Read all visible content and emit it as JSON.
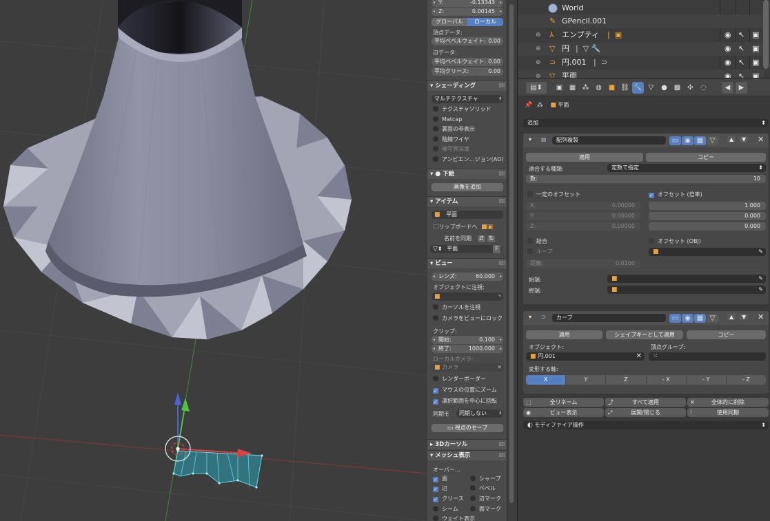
{
  "npanel": {
    "transform": {
      "y_label": "Y:",
      "y_value": "-0.13343",
      "z_label": "Z:",
      "z_value": "0.00145",
      "global_label": "グローバル",
      "local_label": "ローカル",
      "vertex_data_label": "頂点データ:",
      "vertex_bevel_label": "平均ベベルウェイト:",
      "vertex_bevel_value": "0.00",
      "edge_data_label": "辺データ:",
      "edge_bevel_label": "平均ベベルウェイト:",
      "edge_bevel_value": "0.00",
      "crease_label": "平均クリース:",
      "crease_value": "0.00"
    },
    "shading": {
      "header": "シェーディング",
      "mode": "マルチテクスチャ",
      "textured_solid": "テクスチャソリッド",
      "matcap": "Matcap",
      "backface_culling": "裏面の非表示",
      "hidden_wire": "陰線ワイヤ",
      "depth_of_field": "被写界深度",
      "ambient_occlusion": "アンビエン…ジョン(AO)"
    },
    "background": {
      "header": "下絵",
      "add_image": "画像を追加"
    },
    "item": {
      "header": "アイテム",
      "object_name": "平面",
      "clipboard_label": "リップボードへ",
      "sync_name": "名前を同期",
      "data_name": "平面",
      "f_label": "F"
    },
    "view": {
      "header": "ビュー",
      "lens_label": "レンズ:",
      "lens_value": "60.000",
      "lock_object_label": "オブジェクトに注視:",
      "lock_cursor": "カーソルを注視",
      "lock_camera": "カメラをビューにロック",
      "clip_label": "クリップ:",
      "clip_start_label": "開始:",
      "clip_start_value": "0.100",
      "clip_end_label": "終了:",
      "clip_end_value": "1000.000",
      "local_camera_label": "ローカルカメラ:",
      "camera_placeholder": "カメラ",
      "render_border": "レンダーボーダー",
      "zoom_to_mouse": "マウスの位置にズーム",
      "rotate_around_selection": "選択範囲を中心に回転",
      "sync_mode_label": "同期モ",
      "sync_mode_value": "同期しない",
      "save_view": "視点のセーブ"
    },
    "cursor": {
      "header": "3Dカーソル"
    },
    "mesh_display": {
      "header": "メッシュ表示",
      "overlay_label": "オーバー…",
      "faces": "面",
      "sharp": "シャープ",
      "edges": "辺",
      "bevel": "ベベル",
      "crease": "クリース",
      "edge_marks": "辺マーク",
      "seams": "シーム",
      "face_marks": "面マーク",
      "weight": "ウェイト表示"
    }
  },
  "outliner": {
    "rows": [
      {
        "label": "World",
        "icon": "world-icon"
      },
      {
        "label": "GPencil.001",
        "icon": "pencil-icon"
      },
      {
        "label": "エンプティ",
        "icon": "empty-icon"
      },
      {
        "label": "円",
        "icon": "mesh-icon"
      },
      {
        "label": "円.001",
        "icon": "curve-icon"
      },
      {
        "label": "平面",
        "icon": "mesh-icon"
      }
    ]
  },
  "properties": {
    "context_object": "平面",
    "add_modifier": "追加",
    "array": {
      "name": "配列複製",
      "apply": "適用",
      "copy": "コピー",
      "fit_type_label": "適合する種類:",
      "fit_type_value": "定数で指定",
      "count_label": "数:",
      "count_value": "10",
      "constant_offset_label": "一定のオフセット",
      "relative_offset_label": "オフセット (倍率)",
      "const_x_label": "X:",
      "const_x_value": "0.00000",
      "const_y_label": "Y:",
      "const_y_value": "0.00000",
      "const_z_label": "Z:",
      "const_z_value": "0.00000",
      "rel_x_value": "1.000",
      "rel_y_value": "0.000",
      "rel_z_value": "0.000",
      "merge_label": "結合",
      "object_offset_label": "オフセット (OBJ)",
      "loop_label": "ループ",
      "distance_label": "距離:",
      "distance_value": "0.0100",
      "start_cap_label": "始端:",
      "end_cap_label": "終端:"
    },
    "curve": {
      "name": "カーブ",
      "apply": "適用",
      "apply_shape": "シェイプキーとして適用",
      "copy": "コピー",
      "object_label": "オブジェクト:",
      "object_value": "円.001",
      "vertex_group_label": "頂点グループ:",
      "deform_axis_label": "変形する軸:",
      "axes": [
        "X",
        "Y",
        "Z",
        "- X",
        "- Y",
        "- Z"
      ],
      "active_axis": "X"
    },
    "tools": {
      "rename_all": "全リネーム",
      "apply_all": "すべて適用",
      "delete_all": "全体的に削除",
      "viewport_display": "ビュー表示",
      "expand_collapse": "展開/閉じる",
      "toggle_sync": "使用同期",
      "modifier_ops": "モディファイア操作"
    }
  },
  "colors": {
    "accent": "#5680c2",
    "mesh_body": "#8b8d9e",
    "selected_curve": "#5fd5e6",
    "axis_x": "#d84343",
    "axis_y": "#4fc13e",
    "axis_z": "#4a63d8"
  }
}
